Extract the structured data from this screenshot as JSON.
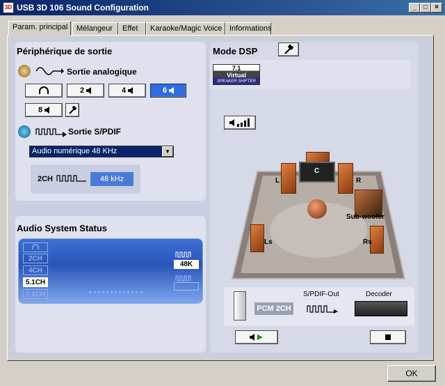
{
  "window": {
    "title": "USB 3D 106 Sound Configuration",
    "min_btn": "_",
    "max_btn": "□",
    "close_btn": "×"
  },
  "tabs": [
    {
      "label": "Param. principal",
      "active": true
    },
    {
      "label": "Mélangeur"
    },
    {
      "label": "Effet"
    },
    {
      "label": "Karaoke/Magic Voice"
    },
    {
      "label": "Informations"
    }
  ],
  "output": {
    "heading": "Périphérique de sortie",
    "analog_label": "Sortie analogique",
    "channel_buttons": [
      {
        "label": "",
        "icon": "headphones-icon"
      },
      {
        "label": "2",
        "icon": "speaker-icon"
      },
      {
        "label": "4",
        "icon": "speaker-icon"
      },
      {
        "label": "6",
        "icon": "speaker-icon",
        "selected": true
      },
      {
        "label": "8",
        "icon": "speaker-icon"
      }
    ],
    "spdif_label": "Sortie S/PDIF",
    "spdif_select_value": "Audio numérique  48 KHz",
    "spdif_channels": "2CH",
    "spdif_rate": "48 kHz"
  },
  "status": {
    "heading": "Audio System Status",
    "channels": [
      {
        "label": "",
        "icon": "headphones-icon"
      },
      {
        "label": "2CH"
      },
      {
        "label": "4CH"
      },
      {
        "label": "5.1CH",
        "active": true
      },
      {
        "label": "7.1CH"
      }
    ],
    "rate": "48K"
  },
  "dsp": {
    "heading": "Mode DSP",
    "virtual_line1": "7.1",
    "virtual_line2": "Virtual",
    "virtual_line3": "SPEAKER SHIFTER",
    "speakers": {
      "c": "C",
      "l": "L",
      "r": "R",
      "ls": "Ls",
      "rs": "Rs",
      "sub": "Sub-woofer"
    },
    "output_format": "PCM 2CH",
    "spdif_out_label": "S/PDIF-Out",
    "decoder_label": "Decoder"
  },
  "ok_label": "OK",
  "colors": {
    "title_start": "#0a246a",
    "title_end": "#3a6ea5",
    "selected": "#2d6de0",
    "panel": "#c9cee0",
    "status": "#2a55b8"
  }
}
